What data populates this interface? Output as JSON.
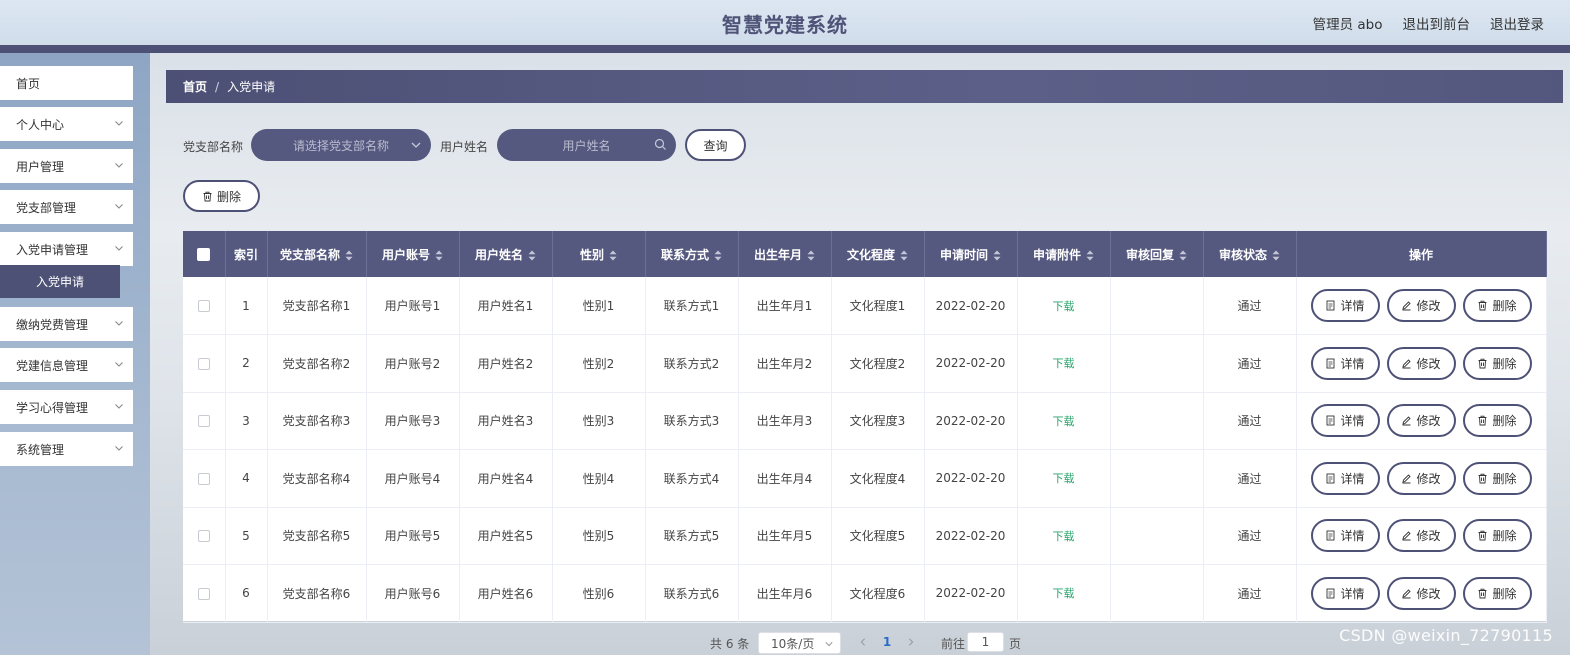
{
  "header": {
    "title": "智慧党建系统",
    "admin_label": "管理员 abo",
    "front_link": "退出到前台",
    "logout_link": "退出登录"
  },
  "sidebar": {
    "items": [
      {
        "label": "首页",
        "has_chevron": false
      },
      {
        "label": "个人中心",
        "has_chevron": true
      },
      {
        "label": "用户管理",
        "has_chevron": true
      },
      {
        "label": "党支部管理",
        "has_chevron": true
      },
      {
        "label": "入党申请管理",
        "has_chevron": true
      },
      {
        "label": "缴纳党费管理",
        "has_chevron": true
      },
      {
        "label": "党建信息管理",
        "has_chevron": true
      },
      {
        "label": "学习心得管理",
        "has_chevron": true
      },
      {
        "label": "系统管理",
        "has_chevron": true
      }
    ],
    "active_sub": "入党申请"
  },
  "breadcrumb": {
    "home": "首页",
    "sep": "/",
    "current": "入党申请"
  },
  "search": {
    "branch_label": "党支部名称",
    "branch_placeholder": "请选择党支部名称",
    "user_label": "用户姓名",
    "user_placeholder": "用户姓名",
    "query_button": "查询"
  },
  "toolbar": {
    "delete_button": "删除"
  },
  "table": {
    "columns": [
      "索引",
      "党支部名称",
      "用户账号",
      "用户姓名",
      "性别",
      "联系方式",
      "出生年月",
      "文化程度",
      "申请时间",
      "申请附件",
      "审核回复",
      "审核状态",
      "操作"
    ],
    "sortable": [
      false,
      true,
      true,
      true,
      true,
      true,
      true,
      true,
      true,
      true,
      true,
      true,
      false
    ],
    "rows": [
      {
        "index": "1",
        "branch": "党支部名称1",
        "account": "用户账号1",
        "name": "用户姓名1",
        "gender": "性别1",
        "contact": "联系方式1",
        "birth": "出生年月1",
        "edu": "文化程度1",
        "date": "2022-02-20",
        "attach": "下载",
        "reply": "",
        "status": "通过"
      },
      {
        "index": "2",
        "branch": "党支部名称2",
        "account": "用户账号2",
        "name": "用户姓名2",
        "gender": "性别2",
        "contact": "联系方式2",
        "birth": "出生年月2",
        "edu": "文化程度2",
        "date": "2022-02-20",
        "attach": "下载",
        "reply": "",
        "status": "通过"
      },
      {
        "index": "3",
        "branch": "党支部名称3",
        "account": "用户账号3",
        "name": "用户姓名3",
        "gender": "性别3",
        "contact": "联系方式3",
        "birth": "出生年月3",
        "edu": "文化程度3",
        "date": "2022-02-20",
        "attach": "下载",
        "reply": "",
        "status": "通过"
      },
      {
        "index": "4",
        "branch": "党支部名称4",
        "account": "用户账号4",
        "name": "用户姓名4",
        "gender": "性别4",
        "contact": "联系方式4",
        "birth": "出生年月4",
        "edu": "文化程度4",
        "date": "2022-02-20",
        "attach": "下载",
        "reply": "",
        "status": "通过"
      },
      {
        "index": "5",
        "branch": "党支部名称5",
        "account": "用户账号5",
        "name": "用户姓名5",
        "gender": "性别5",
        "contact": "联系方式5",
        "birth": "出生年月5",
        "edu": "文化程度5",
        "date": "2022-02-20",
        "attach": "下载",
        "reply": "",
        "status": "通过"
      },
      {
        "index": "6",
        "branch": "党支部名称6",
        "account": "用户账号6",
        "name": "用户姓名6",
        "gender": "性别6",
        "contact": "联系方式6",
        "birth": "出生年月6",
        "edu": "文化程度6",
        "date": "2022-02-20",
        "attach": "下载",
        "reply": "",
        "status": "通过"
      }
    ],
    "actions": {
      "detail": "详情",
      "edit": "修改",
      "delete": "删除"
    }
  },
  "pagination": {
    "total_text": "共 6 条",
    "page_size": "10条/页",
    "current_page": "1",
    "goto_label": "前往",
    "goto_value": "1",
    "page_suffix": "页"
  },
  "watermark": "CSDN @weixin_72790115",
  "colors": {
    "primary": "#4e5176",
    "download": "#2aa66d",
    "header_bg": "#dde7f2"
  },
  "icons": {
    "chevron": "chevron-down-icon",
    "search": "search-icon",
    "trash": "trash-icon",
    "detail": "document-icon",
    "edit": "pencil-icon",
    "sort": "sort-icon"
  }
}
